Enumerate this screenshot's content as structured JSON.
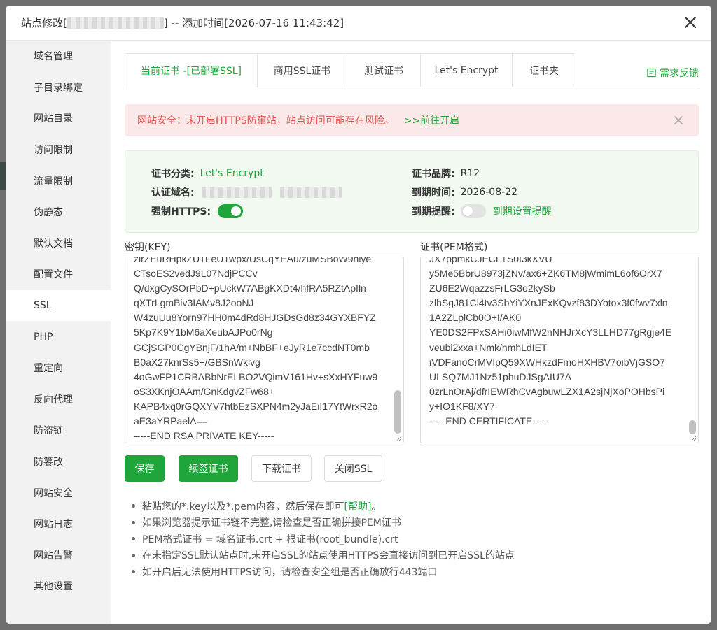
{
  "dialog": {
    "title_prefix": "站点修改[",
    "title_suffix": "] -- 添加时间[2026-07-16 11:43:42]"
  },
  "sidebar": {
    "items": [
      {
        "label": "域名管理"
      },
      {
        "label": "子目录绑定"
      },
      {
        "label": "网站目录"
      },
      {
        "label": "访问限制"
      },
      {
        "label": "流量限制"
      },
      {
        "label": "伪静态"
      },
      {
        "label": "默认文档"
      },
      {
        "label": "配置文件"
      },
      {
        "label": "SSL"
      },
      {
        "label": "PHP"
      },
      {
        "label": "重定向"
      },
      {
        "label": "反向代理"
      },
      {
        "label": "防盗链"
      },
      {
        "label": "防篡改"
      },
      {
        "label": "网站安全"
      },
      {
        "label": "网站日志"
      },
      {
        "label": "网站告警"
      },
      {
        "label": "其他设置"
      }
    ],
    "active": "SSL"
  },
  "tabs": [
    {
      "label": "当前证书 -[已部署SSL]"
    },
    {
      "label": "商用SSL证书"
    },
    {
      "label": "测试证书"
    },
    {
      "label": "Let's Encrypt"
    },
    {
      "label": "证书夹"
    }
  ],
  "feedback_label": "需求反馈",
  "alert": {
    "text": "网站安全：未开启HTTPS防窜站，站点访问可能存在风险。",
    "link": ">>前往开启"
  },
  "cert_info": {
    "category_label": "证书分类:",
    "category_value": "Let's Encrypt",
    "domain_label": "认证域名:",
    "force_https_label": "强制HTTPS:",
    "brand_label": "证书品牌:",
    "brand_value": "R12",
    "expiry_label": "到期时间:",
    "expiry_value": "2026-08-22",
    "reminder_label": "到期提醒:",
    "reminder_link": "到期设置提醒"
  },
  "key_section": {
    "label": "密钥(KEY)",
    "content": "zlrZEuRHpkZU1FeU1wpx/UsCqYEAu/zuMSBoW9hiye\nCTsoES2vedJ9L07NdjPCCv\nQ/dxgCySOrPbD+pUckW7ABgKXDt4/hfRA5RZtApIln\nqXTrLgmBiv3IAMv8J2ooNJ\nW4zuUu8Yorn97HH0m4dRd8HJGDsGd8z34GYXBFYZ\n5Kp7K9Y1bM6aXeubAJPo0rNg\nGCjSGP0CgYBnjF/1hA/m+NbBF+eJyR1e7ccdNT0mb\nB0aX27knrSs5+/GBSnWklvg\n4oGwFP1CRBABbNrELBO2VQimV161Hv+sXxHYFuw9\noS3XKnjOAAm/GnKdgvZFw68+\nKAPB4xq0rGQXYV7htbEzSXPN4m2yJaEiI17YtWrxR2o\naE3aYRPaelA==\n-----END RSA PRIVATE KEY-----"
  },
  "cert_section": {
    "label": "证书(PEM格式)",
    "content": "JX7ppmkCJECL+S0I3kXVU\ny5Me5BbrU8973jZNv/ax6+ZK6TM8jWmimL6of6OrX7\nZU6E2WqazzsFrLG3o2kySb\nzlhSgJ81Cl4tv3SbYiYXnJExKQvzf83DYotox3f0fwv7xln\n1A2ZLplCb0O+I/AK0\nYE0DS2FPxSAHi0iwMfW2nNHJrXcY3LLHD77gRgje4E\nveubi2xxa+Nmk/hmhLdIET\niVDFanoCrMVIpQ59XWHkzdFmoHXHBV7oibVjGSO7\nULSQ7MJ1Nz51phuDJSgAIU7A\n0zrLnOrAj/dfrIEWRhCvAgbuwLZX1A2sjNjXoPOHbsPi\ny+IO1KF8/XY7\n-----END CERTIFICATE-----"
  },
  "buttons": {
    "save": "保存",
    "renew": "续签证书",
    "download": "下载证书",
    "close_ssl": "关闭SSL"
  },
  "tips": [
    {
      "text": "粘贴您的*.key以及*.pem内容，然后保存即可",
      "link": "[帮助]",
      "after": "。"
    },
    {
      "text": "如果浏览器提示证书链不完整,请检查是否正确拼接PEM证书"
    },
    {
      "text": "PEM格式证书 = 域名证书.crt + 根证书(root_bundle).crt"
    },
    {
      "text": "在未指定SSL默认站点时,未开启SSL的站点使用HTTPS会直接访问到已开启SSL的站点"
    },
    {
      "text": "如开启后无法使用HTTPS访问，请检查安全组是否正确放行443端口"
    }
  ],
  "colors": {
    "accent": "#20a53a",
    "alert_text": "#e85353",
    "alert_bg": "#fbe9e9",
    "info_bg": "#f1f9f0"
  },
  "icons": {
    "close": "close-icon",
    "feedback": "feedback-icon",
    "alert_close": "alert-close-icon"
  },
  "toggles": {
    "force_https": true,
    "expiry_reminder": false
  }
}
